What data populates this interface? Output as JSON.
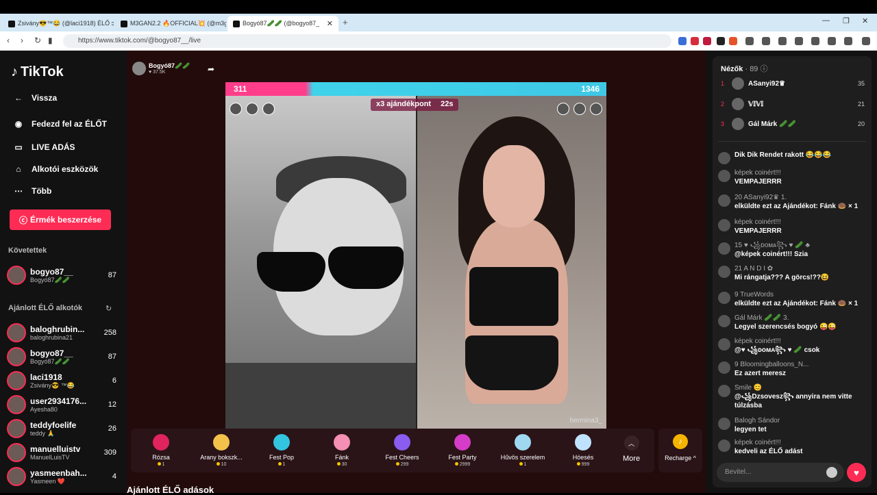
{
  "browser": {
    "tabs": [
      {
        "title": "Zsivány😎™😂 (@laci1918) ÉLŐ ɔ"
      },
      {
        "title": "M3GAN2.2 🔥OFFICIAL💥 (@m3g"
      },
      {
        "title": "Bogyó87🥒🥒 (@bogyo87_"
      }
    ],
    "new_tab": "+",
    "url": "https://www.tiktok.com/@bogyo87__/live"
  },
  "sidebar": {
    "logo": "TikTok",
    "nav": [
      {
        "label": "Vissza",
        "icon": "back-arrow-icon"
      },
      {
        "label": "Fedezd fel az ÉLŐT",
        "icon": "explore-icon"
      },
      {
        "label": "LIVE ADÁS",
        "icon": "video-icon"
      },
      {
        "label": "Alkotói eszközök",
        "icon": "creator-tools-icon"
      },
      {
        "label": "Több",
        "icon": "more-dots-icon"
      }
    ],
    "coins_button": "Érmék beszerzése",
    "following_title": "Követettek",
    "following": [
      {
        "name": "bogyo87__",
        "sub": "Bogyó87🥒🥒",
        "count": "87"
      }
    ],
    "recommended_title": "Ajánlott ÉLŐ alkotók",
    "recommended": [
      {
        "name": "baloghrubin...",
        "sub": "baloghrubina21",
        "count": "258"
      },
      {
        "name": "bogyo87__",
        "sub": "Bogyó87🥒🥒",
        "count": "87"
      },
      {
        "name": "laci1918",
        "sub": "Zsivány😎 ™😂",
        "count": "6"
      },
      {
        "name": "user2934176...",
        "sub": "Ayesha80",
        "count": "12"
      },
      {
        "name": "teddyfoelife",
        "sub": "teddy 🙏",
        "count": "26"
      },
      {
        "name": "manuelluistv",
        "sub": "ManuelLuisTV",
        "count": "309"
      },
      {
        "name": "yasmeenbah...",
        "sub": "Yasmeen ❤️",
        "count": "4"
      }
    ]
  },
  "stream": {
    "host_name": "Bogyó87🥒🥒",
    "host_likes": "♥ 37.5K",
    "score_left": "311",
    "score_right": "1346",
    "gift_tag": "x3 ajándékpont",
    "timer": "22s",
    "watermark": "hermina3_"
  },
  "gifts": [
    {
      "name": "Rózsa",
      "price": "1",
      "color": "#e0245e"
    },
    {
      "name": "Arany bokszk...",
      "price": "10",
      "color": "#f3c24a"
    },
    {
      "name": "Fest Pop",
      "price": "1",
      "color": "#33c4e0"
    },
    {
      "name": "Fánk",
      "price": "30",
      "color": "#f58fb4"
    },
    {
      "name": "Fest Cheers",
      "price": "299",
      "color": "#8a5cf0"
    },
    {
      "name": "Fest Party",
      "price": "2999",
      "color": "#d53cc7"
    },
    {
      "name": "Hűvös szerelem",
      "price": "1",
      "color": "#9fd8f0"
    },
    {
      "name": "Hóesés",
      "price": "999",
      "color": "#bfe3ff"
    }
  ],
  "more_label": "More",
  "recharge_label": "Recharge ^",
  "bottom_title": "Ajánlott ÉLŐ adások",
  "chat": {
    "viewers_title": "Nézők",
    "viewers_count": "· 89",
    "top_viewers": [
      {
        "rank": "1",
        "name": "ASanyi92♛",
        "score": "35"
      },
      {
        "rank": "2",
        "name": "𝕍𝕀𝕍𝕀",
        "score": "21"
      },
      {
        "rank": "3",
        "name": "Gál Márk 🥒🥒",
        "score": "20"
      }
    ],
    "messages": [
      {
        "user": "",
        "text": "Dik Dik Rendet rakott 😂😂😂"
      },
      {
        "user": "képek coinért!!!",
        "text": "VEMPAJERRR"
      },
      {
        "user": "20 ASanyi92♛ 1.",
        "text": "elküldte ezt az Ajándékot: Fánk 🍩 × 1"
      },
      {
        "user": "képek coinért!!!",
        "text": "VEMPAJERRR"
      },
      {
        "user": "15 ♥ ꧁ᴅᴏᴍᴀ꧂ ♥ 🥒 ♣",
        "text": "@képek coinért!!! Szia"
      },
      {
        "user": "21 A N D I ✿",
        "text": "Mi rángatja??? A görcs!??😆"
      },
      {
        "user": "9 TrueWords",
        "text": "elküldte ezt az Ajándékot: Fánk 🍩 × 1"
      },
      {
        "user": "Gál Márk 🥒🥒 3.",
        "text": "Legyel szerencsés bogyó 😜😜"
      },
      {
        "user": "képek coinért!!!",
        "text": "@♥ ꧁ᴅᴏᴍᴀ꧂ ♥ 🥒 csok"
      },
      {
        "user": "9 Bloomingballoons_N...",
        "text": "Ez azert meresz"
      },
      {
        "user": "Smile 😊",
        "text": "@꧁Dzsovesz꧂ annyira nem vitte túlzásba"
      },
      {
        "user": "Balogh Sándor",
        "text": "legyen tet"
      },
      {
        "user": "képek coinért!!!",
        "text": "kedveli az ÉLŐ adást"
      }
    ],
    "input_placeholder": "Bevitel..."
  }
}
